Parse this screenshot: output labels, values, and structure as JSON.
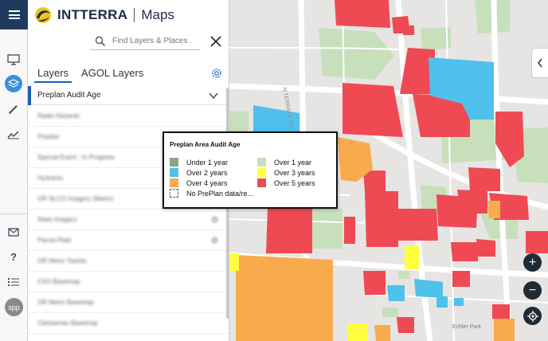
{
  "brand": {
    "name": "INTTERRA",
    "product": "Maps"
  },
  "search": {
    "placeholder": "Find Layers & Places ..."
  },
  "tabs": [
    {
      "label": "Layers"
    },
    {
      "label": "AGOL Layers"
    }
  ],
  "active_layer": {
    "label": "Preplan Audit Age"
  },
  "user": {
    "initials": "spp"
  },
  "layers": [
    {
      "label": "Radio Hazards",
      "info": false
    },
    {
      "label": "Preplan",
      "info": false
    },
    {
      "label": "Special Event - In Progress",
      "info": false
    },
    {
      "label": "Hydrants",
      "info": false
    },
    {
      "label": "OR SLCO Imagery (Metro)",
      "info": false
    },
    {
      "label": "State Imagery",
      "info": true
    },
    {
      "label": "Parcel Plats",
      "info": true
    },
    {
      "label": "OR Metro Taxlots",
      "info": false
    },
    {
      "label": "CSO Basemap",
      "info": false
    },
    {
      "label": "OR Metro Basemap",
      "info": false
    },
    {
      "label": "Clackamas Basemap",
      "info": false
    }
  ],
  "legend": {
    "title": "Preplan Area Audit Age",
    "items": [
      {
        "label": "Under 1 year",
        "color": "#8aa97a"
      },
      {
        "label": "Over 1 year",
        "color": "#c8dfb9"
      },
      {
        "label": "Over 2 years",
        "color": "#4fc1ec"
      },
      {
        "label": "Over 3 years",
        "color": "#ffff40"
      },
      {
        "label": "Over 4 years",
        "color": "#f7ab4d"
      },
      {
        "label": "Over 5 years",
        "color": "#ef4a54"
      },
      {
        "label": "No PrePlan data/re...",
        "color": ""
      }
    ]
  },
  "map": {
    "road_labels": [
      "N TERRACE RD",
      "Echler Park"
    ],
    "colors": {
      "background": "#e6e5e3",
      "park": "#c7dfbb",
      "road": "#ffffff",
      "red": "#ef4a54",
      "orange": "#f7ab4d",
      "blue": "#4fc1ec",
      "yellow": "#ffff40"
    }
  },
  "controls": {
    "zoom_in": "+",
    "zoom_out": "−"
  }
}
